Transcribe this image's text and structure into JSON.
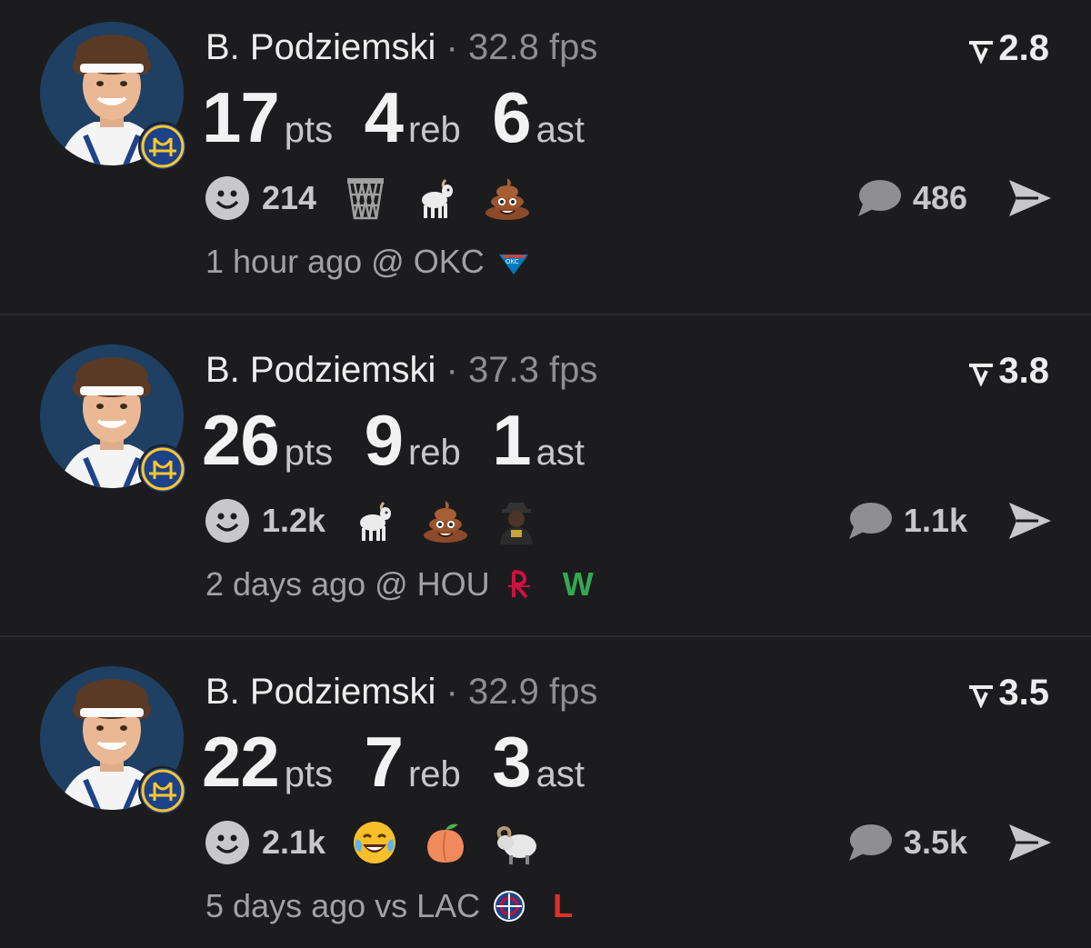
{
  "colors": {
    "background": "#1c1c1e",
    "win": "#34a853",
    "loss": "#e0302a",
    "muted": "#8e8e93"
  },
  "cards": [
    {
      "player": "B. Podziemski",
      "separator": "·",
      "fps": "32.8 fps",
      "rating": "2.8",
      "stats": [
        {
          "value": "17",
          "unit": "pts"
        },
        {
          "value": "4",
          "unit": "reb"
        },
        {
          "value": "6",
          "unit": "ast"
        }
      ],
      "reaction_count": "214",
      "emojis": [
        "basketball-net-icon",
        "goat-icon",
        "poop-icon"
      ],
      "comment_count": "486",
      "time": "1 hour ago @ OKC",
      "opponent_logo": "okc-logo-icon",
      "result": ""
    },
    {
      "player": "B. Podziemski",
      "separator": "·",
      "fps": "37.3 fps",
      "rating": "3.8",
      "stats": [
        {
          "value": "26",
          "unit": "pts"
        },
        {
          "value": "9",
          "unit": "reb"
        },
        {
          "value": "1",
          "unit": "ast"
        }
      ],
      "reaction_count": "1.2k",
      "emojis": [
        "goat-icon",
        "poop-icon",
        "person-sticker-icon"
      ],
      "comment_count": "1.1k",
      "time": "2 days ago @ HOU",
      "opponent_logo": "hou-logo-icon",
      "result": "W"
    },
    {
      "player": "B. Podziemski",
      "separator": "·",
      "fps": "32.9 fps",
      "rating": "3.5",
      "stats": [
        {
          "value": "22",
          "unit": "pts"
        },
        {
          "value": "7",
          "unit": "reb"
        },
        {
          "value": "3",
          "unit": "ast"
        }
      ],
      "reaction_count": "2.1k",
      "emojis": [
        "laughing-tears-icon",
        "peach-icon",
        "ram-icon"
      ],
      "comment_count": "3.5k",
      "time": "5 days ago vs LAC",
      "opponent_logo": "lac-logo-icon",
      "result": "L"
    }
  ]
}
